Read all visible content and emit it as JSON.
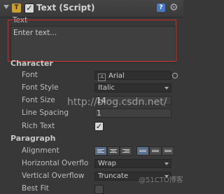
{
  "header": {
    "script_icon": "T",
    "enabled_check": "✓",
    "title": "Text (Script)",
    "help_icon": "?",
    "gear_icon": "⚙"
  },
  "text": {
    "label": "Text",
    "value": "Enter text..."
  },
  "character": {
    "heading": "Character",
    "font_label": "Font",
    "font_icon": "A",
    "font_value": "Arial",
    "font_style_label": "Font Style",
    "font_style_value": "Italic",
    "font_size_label": "Font Size",
    "font_size_value": "14",
    "line_spacing_label": "Line Spacing",
    "line_spacing_value": "1",
    "rich_text_label": "Rich Text",
    "rich_text_check": "✓"
  },
  "paragraph": {
    "heading": "Paragraph",
    "alignment_label": "Alignment",
    "h_overflow_label": "Horizontal Overflo",
    "h_overflow_value": "Wrap",
    "v_overflow_label": "Vertical Overflow",
    "v_overflow_value": "Truncate",
    "best_fit_label": "Best Fit"
  },
  "watermarks": {
    "url": "http://blog.csdn.net/",
    "cto": "@51CTO博客"
  },
  "colors": {
    "panel_bg": "#383838",
    "highlight": "#d42a2a",
    "active_align": "#5a6d8c"
  }
}
